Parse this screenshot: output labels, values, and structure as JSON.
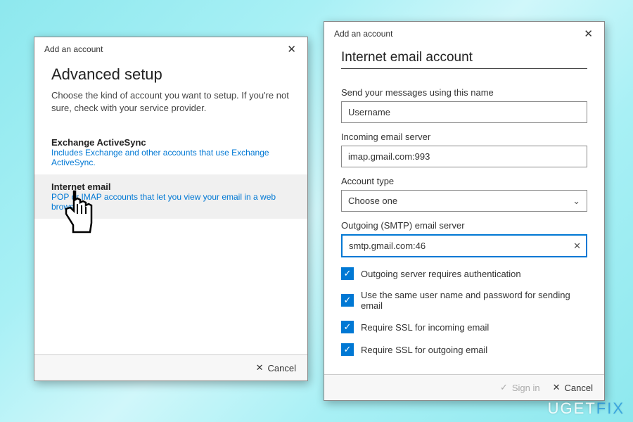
{
  "dialog_title": "Add an account",
  "left": {
    "heading": "Advanced setup",
    "description": "Choose the kind of account you want to setup. If you're not sure, check with your service provider.",
    "options": [
      {
        "title": "Exchange ActiveSync",
        "desc": "Includes Exchange and other accounts that use Exchange ActiveSync."
      },
      {
        "title": "Internet email",
        "desc": "POP or IMAP accounts that let you view your email in a web browser."
      }
    ],
    "cancel": "Cancel"
  },
  "right": {
    "heading": "Internet email account",
    "fields": {
      "name_label": "Send your messages using this name",
      "name_value": "Username",
      "incoming_label": "Incoming email server",
      "incoming_value": "imap.gmail.com:993",
      "account_type_label": "Account type",
      "account_type_value": "Choose one",
      "outgoing_label": "Outgoing (SMTP) email server",
      "outgoing_value": "smtp.gmail.com:46"
    },
    "checkboxes": [
      "Outgoing server requires authentication",
      "Use the same user name and password for sending email",
      "Require SSL for incoming email",
      "Require SSL for outgoing email"
    ],
    "signin": "Sign in",
    "cancel": "Cancel"
  },
  "watermark": {
    "a": "UGET",
    "b": "FIX"
  }
}
